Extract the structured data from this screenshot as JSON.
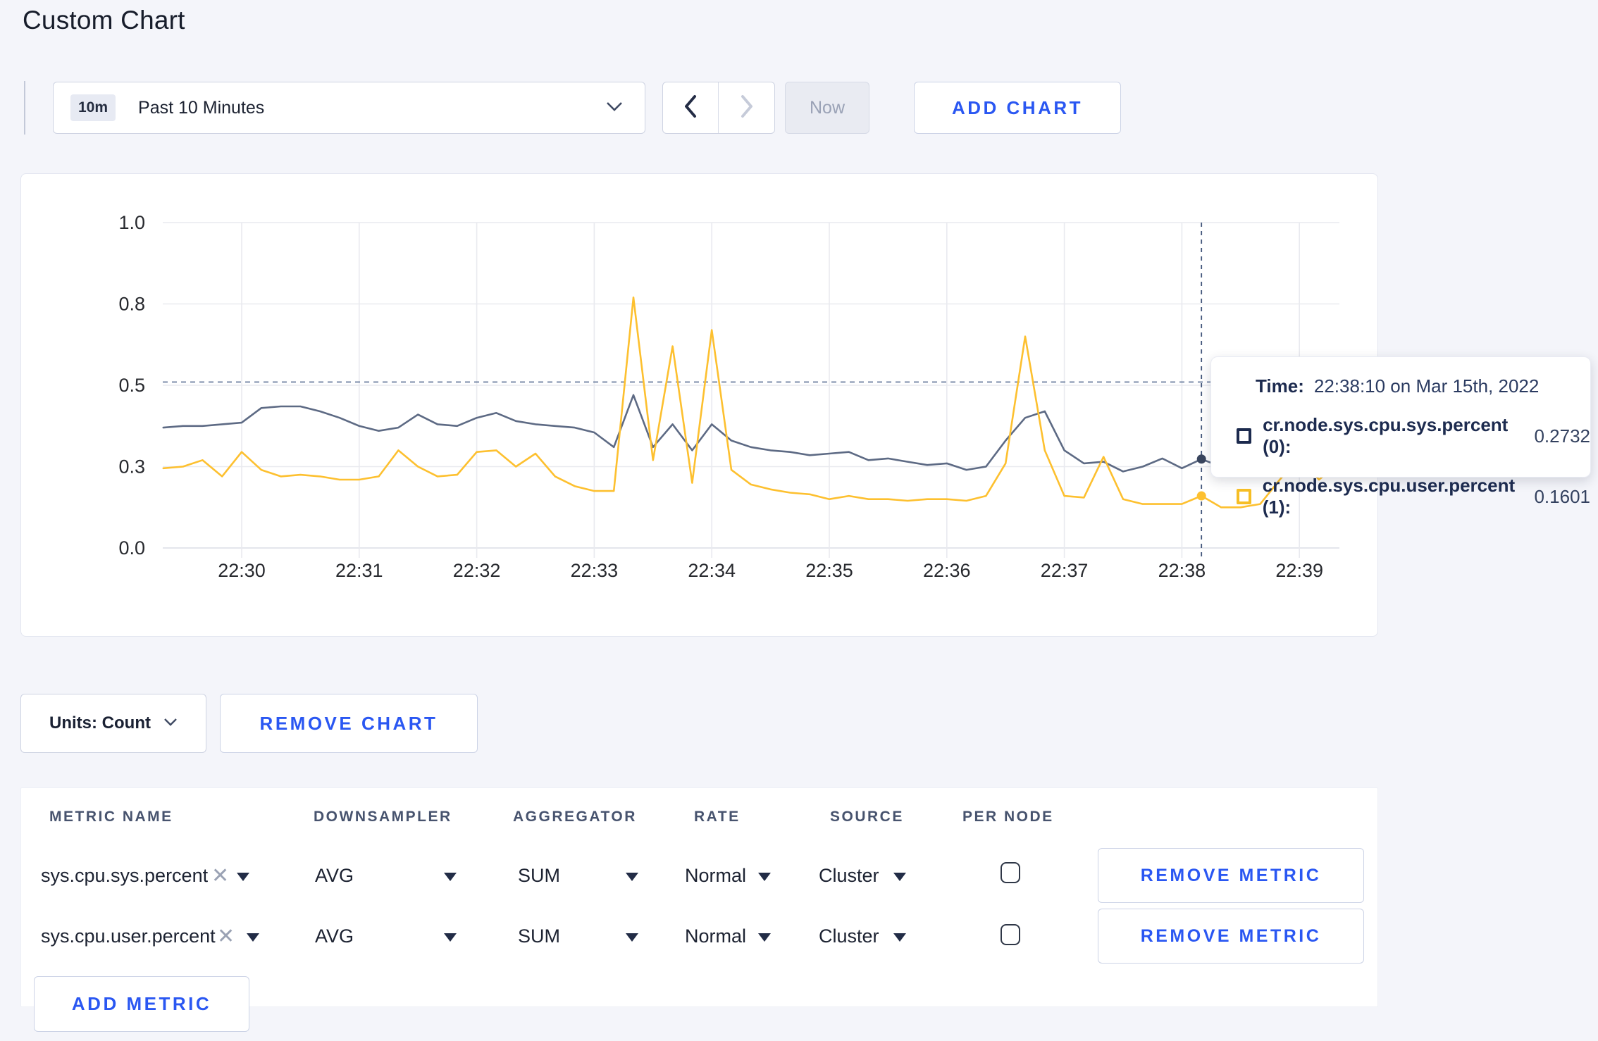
{
  "page": {
    "title": "Custom Chart",
    "background": "#f4f5fa",
    "accent_blue": "#2a57f2"
  },
  "toolbar": {
    "time_window_badge": "10m",
    "time_window_label": "Past 10 Minutes",
    "now_label": "Now",
    "add_chart_label": "ADD CHART",
    "icons": {
      "dropdown_chevron": "chevron-down",
      "prev": "chevron-left",
      "next": "chevron-right"
    }
  },
  "chart_data": {
    "type": "line",
    "title": "",
    "xlabel": "",
    "ylabel": "",
    "ylim": [
      0,
      1
    ],
    "grid": true,
    "x_tick_labels": [
      "22:30",
      "22:31",
      "22:32",
      "22:33",
      "22:34",
      "22:35",
      "22:36",
      "22:37",
      "22:38",
      "22:39"
    ],
    "y_tick_labels": [
      "0.0",
      "0.3",
      "0.5",
      "0.8",
      "1.0"
    ],
    "y_tick_values": [
      0,
      0.25,
      0.5,
      0.75,
      1.0
    ],
    "x_start_time": "22:29:20",
    "x_step_seconds": 10,
    "first_point_offset_seconds": -40,
    "grid_color": "#e9eaef",
    "axis_line_color": "#dcdee6",
    "tick_label_color": "#27292e",
    "crosshair": {
      "color": "#41557a",
      "time": "22:38:10",
      "x_offset_seconds": 490,
      "hline_value": 0.51,
      "point_index": 53
    },
    "series": [
      {
        "name": "cr.node.sys.cpu.sys.percent",
        "color": "#5d6a84",
        "dot_color": "#39455e",
        "values": [
          0.37,
          0.375,
          0.375,
          0.38,
          0.385,
          0.43,
          0.435,
          0.435,
          0.42,
          0.4,
          0.375,
          0.36,
          0.37,
          0.41,
          0.38,
          0.375,
          0.4,
          0.415,
          0.39,
          0.38,
          0.375,
          0.37,
          0.355,
          0.31,
          0.47,
          0.31,
          0.38,
          0.3,
          0.38,
          0.33,
          0.31,
          0.3,
          0.295,
          0.285,
          0.29,
          0.295,
          0.27,
          0.275,
          0.265,
          0.255,
          0.26,
          0.24,
          0.25,
          0.33,
          0.4,
          0.42,
          0.3,
          0.26,
          0.265,
          0.235,
          0.25,
          0.275,
          0.245,
          0.2732,
          0.25,
          0.26,
          0.27,
          0.26,
          0.27,
          0.27,
          0.275
        ]
      },
      {
        "name": "cr.node.sys.cpu.user.percent",
        "color": "#fdc02f",
        "dot_color": "#fdc02f",
        "values": [
          0.245,
          0.25,
          0.27,
          0.22,
          0.295,
          0.24,
          0.22,
          0.225,
          0.22,
          0.21,
          0.21,
          0.22,
          0.3,
          0.25,
          0.22,
          0.225,
          0.295,
          0.3,
          0.25,
          0.29,
          0.22,
          0.19,
          0.175,
          0.175,
          0.77,
          0.27,
          0.62,
          0.2,
          0.67,
          0.24,
          0.195,
          0.18,
          0.17,
          0.165,
          0.15,
          0.16,
          0.15,
          0.15,
          0.145,
          0.15,
          0.15,
          0.145,
          0.16,
          0.26,
          0.65,
          0.3,
          0.16,
          0.155,
          0.28,
          0.15,
          0.135,
          0.135,
          0.135,
          0.1601,
          0.125,
          0.125,
          0.135,
          0.21,
          0.28,
          0.21,
          0.26
        ]
      }
    ]
  },
  "tooltip": {
    "time_label": "Time:",
    "time_value": "22:38:10 on Mar 15th, 2022",
    "rows": [
      {
        "name": "cr.node.sys.cpu.sys.percent (0):",
        "value": "0.2732",
        "swatch_color": "#1c2a4e"
      },
      {
        "name": "cr.node.sys.cpu.user.percent (1):",
        "value": "0.1601",
        "swatch_color": "#f6be25"
      }
    ]
  },
  "chart_controls": {
    "units_label": "Units: Count",
    "remove_chart_label": "REMOVE CHART"
  },
  "metrics_table": {
    "headers": [
      "METRIC NAME",
      "DOWNSAMPLER",
      "AGGREGATOR",
      "RATE",
      "SOURCE",
      "PER NODE"
    ],
    "rows": [
      {
        "metric": "sys.cpu.sys.percent",
        "downsampler": "AVG",
        "aggregator": "SUM",
        "rate": "Normal",
        "source": "Cluster",
        "per_node_checked": false,
        "remove_label": "REMOVE METRIC"
      },
      {
        "metric": "sys.cpu.user.percent",
        "downsampler": "AVG",
        "aggregator": "SUM",
        "rate": "Normal",
        "source": "Cluster",
        "per_node_checked": false,
        "remove_label": "REMOVE METRIC"
      }
    ],
    "add_metric_label": "ADD METRIC"
  }
}
